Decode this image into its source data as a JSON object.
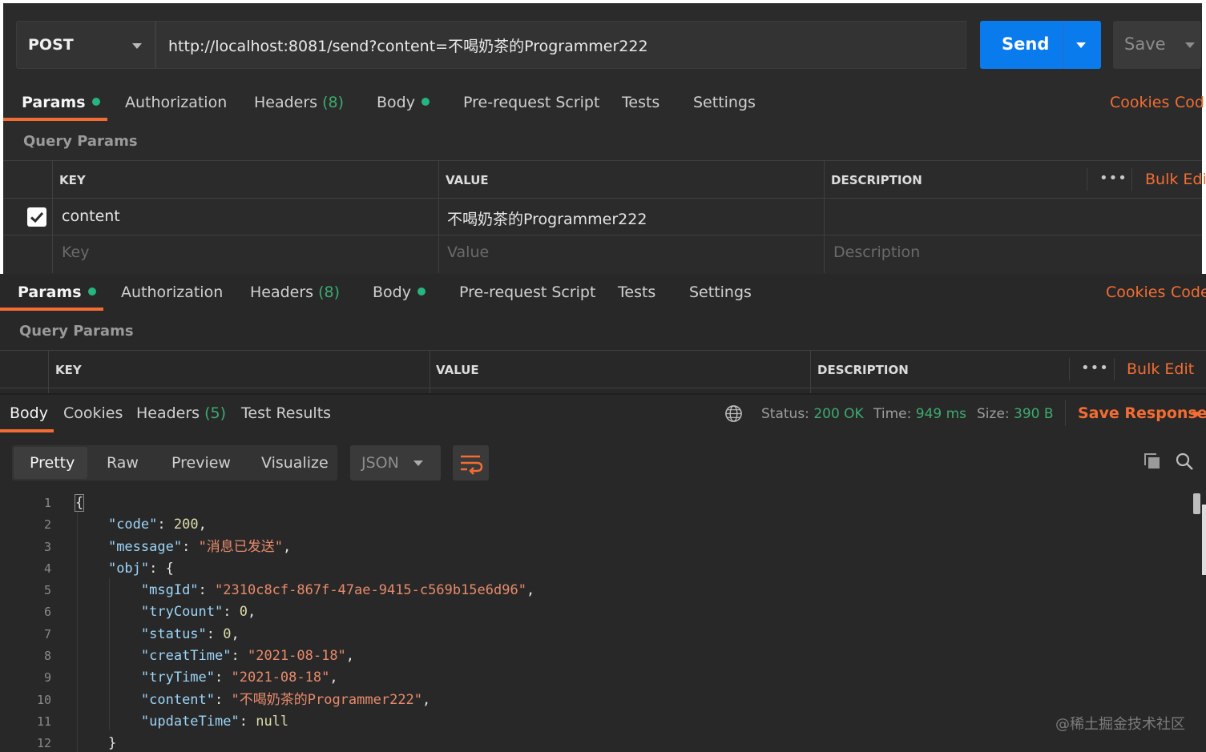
{
  "request": {
    "method": "POST",
    "url": "http://localhost:8081/send?content=不喝奶茶的Programmer222",
    "send_label": "Send",
    "save_label": "Save"
  },
  "tabs": [
    {
      "label": "Params",
      "dot": true,
      "active": true
    },
    {
      "label": "Authorization"
    },
    {
      "label": "Headers",
      "count": "(8)"
    },
    {
      "label": "Body",
      "dot": true
    },
    {
      "label": "Pre-request Script"
    },
    {
      "label": "Tests"
    },
    {
      "label": "Settings"
    }
  ],
  "links_top": {
    "cookies": "Cookies",
    "code": "Cod"
  },
  "links_bottom": {
    "cookies": "Cookies",
    "code": "Code"
  },
  "query_params_title": "Query Params",
  "params_table": {
    "headers": {
      "key": "KEY",
      "value": "VALUE",
      "description": "DESCRIPTION"
    },
    "more_icon": "•••",
    "bulk_edit_top": "Bulk Edit",
    "bulk_edit_bottom": "Bulk Edit",
    "rows": [
      {
        "checked": true,
        "key": "content",
        "value": "不喝奶茶的Programmer222",
        "description": ""
      }
    ],
    "placeholders": {
      "key": "Key",
      "value": "Value",
      "description": "Description"
    }
  },
  "response": {
    "tabs": [
      {
        "label": "Body",
        "active": true
      },
      {
        "label": "Cookies"
      },
      {
        "label": "Headers",
        "count": "(5)"
      },
      {
        "label": "Test Results"
      }
    ],
    "status_label": "Status:",
    "status_value": "200 OK",
    "time_label": "Time:",
    "time_value": "949 ms",
    "size_label": "Size:",
    "size_value": "390 B",
    "save_response": "Save Response",
    "view_modes": [
      "Pretty",
      "Raw",
      "Preview",
      "Visualize"
    ],
    "format": "JSON",
    "line_numbers": [
      "1",
      "2",
      "3",
      "4",
      "5",
      "6",
      "7",
      "8",
      "9",
      "10",
      "11",
      "12"
    ],
    "code_lines": [
      "{",
      "    \"code\": 200,",
      "    \"message\": \"消息已发送\",",
      "    \"obj\": {",
      "        \"msgId\": \"2310c8cf-867f-47ae-9415-c569b15e6d96\",",
      "        \"tryCount\": 0,",
      "        \"status\": 0,",
      "        \"creatTime\": \"2021-08-18\",",
      "        \"tryTime\": \"2021-08-18\",",
      "        \"content\": \"不喝奶茶的Programmer222\",",
      "        \"updateTime\": null",
      "    }"
    ]
  },
  "watermark": "@稀土掘金技术社区",
  "colors": {
    "accent": "#f36d33",
    "send": "#097bed",
    "success": "#3cab6f",
    "bg": "#2b2b2b"
  }
}
